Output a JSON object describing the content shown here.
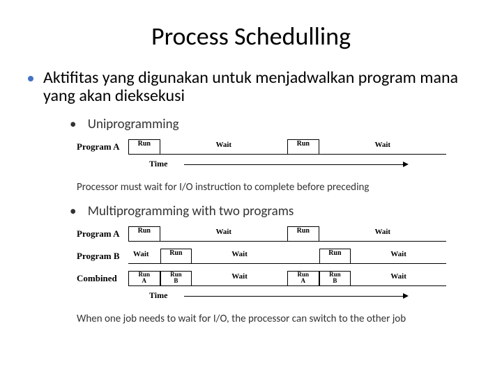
{
  "title": "Process Schedulling",
  "bullet_main": "Aktifitas yang digunakan untuk menjadwalkan program mana yang akan dieksekusi",
  "section1": {
    "heading": "Uniprogramming",
    "programA_label": "Program A",
    "run_label": "Run",
    "wait_label": "Wait",
    "time_label": "Time",
    "note": "Processor must wait for I/O instruction to complete before preceding"
  },
  "section2": {
    "heading": "Multiprogramming with two programs",
    "programA_label": "Program A",
    "programB_label": "Program B",
    "combined_label": "Combined",
    "run_label": "Run",
    "wait_label": "Wait",
    "runA_label": "Run\nA",
    "runB_label": "Run\nB",
    "time_label": "Time",
    "note": "When one job needs to wait for I/O, the processor can switch to the other job"
  },
  "chart_data": [
    {
      "type": "table",
      "title": "Uniprogramming timeline",
      "rows": [
        {
          "program": "A",
          "segments": [
            "Run",
            "Wait",
            "Run",
            "Wait"
          ]
        }
      ],
      "xlabel": "Time"
    },
    {
      "type": "table",
      "title": "Multiprogramming with two programs timeline",
      "rows": [
        {
          "program": "A",
          "segments": [
            "Run",
            "Wait",
            "Run",
            "Wait"
          ]
        },
        {
          "program": "B",
          "segments": [
            "Wait",
            "Run",
            "Wait",
            "Run",
            "Wait"
          ]
        },
        {
          "program": "Combined",
          "segments": [
            "Run A",
            "Run B",
            "Wait",
            "Run A",
            "Run B",
            "Wait"
          ]
        }
      ],
      "xlabel": "Time"
    }
  ]
}
